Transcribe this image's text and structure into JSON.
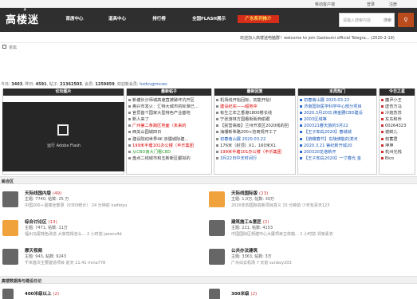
{
  "topbar": {
    "mobile": "移动客户端",
    "login": "登录",
    "register": "注册"
  },
  "header": {
    "logo": "高楼迷",
    "logo_small": "1",
    "nav": [
      "首席中心",
      "道具中心",
      "排行榜",
      "全国FLASH展示",
      "广东系列推介"
    ],
    "search_placeholder": "请输入搜索内容",
    "search_scope": "搜索"
  },
  "notice": "欢迎加入高楼迷电脑群！welcome to join Gaoloumi official Telegra... (2020-2-19)",
  "breadcrumb": "论坛",
  "stats": {
    "today_label": "今日:",
    "today": "3403",
    "yesterday_label": "昨日:",
    "yesterday": "4591",
    "posts_label": "帖子:",
    "posts": "21362503",
    "members_label": "会员:",
    "members": "1259859",
    "welcome": "欢迎新会员:",
    "new_member": "hzdvvgrmcws"
  },
  "portal": {
    "titles": [
      "论坛图片",
      "最新帖子",
      "最新回复",
      "本周热门",
      "今日之星"
    ],
    "flash_label": "运行 Adobe Flash",
    "latest_posts": [
      {
        "t": "新塘长沙师城高速直被破坏坑开区",
        "c": "#333"
      },
      {
        "t": "奥兴市发火：汇特大城市的标准已...",
        "c": "#333"
      },
      {
        "t": "官员首个国家大型特色产业基地",
        "c": "#333"
      },
      {
        "t": "新人来了",
        "c": "#333"
      },
      {
        "t": "广州第二条跨区地面（未来的",
        "c": "red"
      },
      {
        "t": "西关山园城四日",
        "c": "#333"
      },
      {
        "t": "建设院动世界4K 京疆城际建...",
        "c": "#333"
      },
      {
        "t": "199米半塘101办公楼（丰乐集团",
        "c": "red"
      },
      {
        "t": "从CBD南大门看CBD",
        "c": "green"
      },
      {
        "t": "盘点二线城市和五新新区都拟的",
        "c": "#333"
      }
    ],
    "latest_replies": [
      {
        "t": "机场线开始回标，初能开始！",
        "c": "#333"
      },
      {
        "t": "建设纪实——超地中",
        "c": "red"
      },
      {
        "t": "有生之年之香港1800楼长线",
        "c": "#333"
      },
      {
        "t": "宁张游林方国看街街商偷跟",
        "c": "#333"
      },
      {
        "t": "【民营高级】兰州开发区2020线的回",
        "c": "#333"
      },
      {
        "t": "海珊新希路200+范商规开工了",
        "c": "#333"
      },
      {
        "t": "初春南山展 2020.03.22",
        "c": "blue"
      },
      {
        "t": "176米（封顶）X1，160米X1",
        "c": "#333"
      },
      {
        "t": "199米半塘101办公楼（丰乐集团",
        "c": "red"
      },
      {
        "t": "3月22日中天时间行",
        "c": "blue"
      }
    ],
    "weekly_hot": [
      {
        "t": "初春南山展 2020.03.22",
        "c": "blue"
      },
      {
        "t": "济南国际医学科学中心部分项目",
        "c": "blue"
      },
      {
        "t": "2020.3月20日.佛金腰CBD建设",
        "c": "blue"
      },
      {
        "t": "2003区域等",
        "c": "blue"
      },
      {
        "t": "200321春天旅的3月22",
        "c": "blue"
      },
      {
        "t": "【王子知岛2020】春城城",
        "c": "blue"
      },
      {
        "t": "【俯瞰春节】东陵佛能的滨河",
        "c": "blue"
      },
      {
        "t": "2020.3.21 第纪新开城20",
        "c": "blue"
      },
      {
        "t": "200320龙塔新开",
        "c": "blue"
      },
      {
        "t": "【王子知岛2020】一寸春光 金",
        "c": "blue"
      }
    ],
    "stars": [
      "魔尹小王",
      "虚伤万马",
      "冷炮苏苏",
      "东东和乔",
      "00264323",
      "谢鲜儿",
      "刻蓄君",
      "坤坤",
      "杭州光栈",
      "Bico"
    ]
  },
  "sections": {
    "main": "综合区",
    "main2": "高楼数据库与建设日记"
  },
  "forums": [
    {
      "name": "天际线国内版",
      "count": "(49)",
      "stats": "主题: 7740, 帖数: 25 万",
      "last": "中国200＋屋楼全部录（0303统计） 24 分钟前 luofeiyu"
    },
    {
      "name": "天际线国际版",
      "count": "(23)",
      "stats": "主题: 1,0万, 帖数: 30万",
      "last": "2020年四国际高新项目意义 15 分钟前 少年包青天123"
    },
    {
      "name": "综合讨论区",
      "count": "(13)",
      "stats": "主题: 7471, 帖数: 11万",
      "last": "福州马尾特色改造 大家觉得怎么... 2 小时前 jasons4d"
    },
    {
      "name": "建筑施工&意匠",
      "count": "(2)",
      "stats": "主题: 221, 帖数: 4153",
      "last": "中国国际区规建中心大厦项目主体施... 1 小时前 邻家素衣"
    },
    {
      "name": "摩天视频",
      "count": "",
      "stats": "主题: 943, 帖数: 9243",
      "last": "千米首次主要建造项目 前天 11:41 mina778"
    },
    {
      "name": "公共办法建筑",
      "count": "",
      "stats": "主题: 3363, 帖数: 3万",
      "last": "广州白云机场 7 天前 sunboy203"
    },
    {
      "name": "400米级以上",
      "count": "(2)",
      "stats": "",
      "last": ""
    },
    {
      "name": "300米级",
      "count": "(2)",
      "stats": "",
      "last": ""
    }
  ]
}
